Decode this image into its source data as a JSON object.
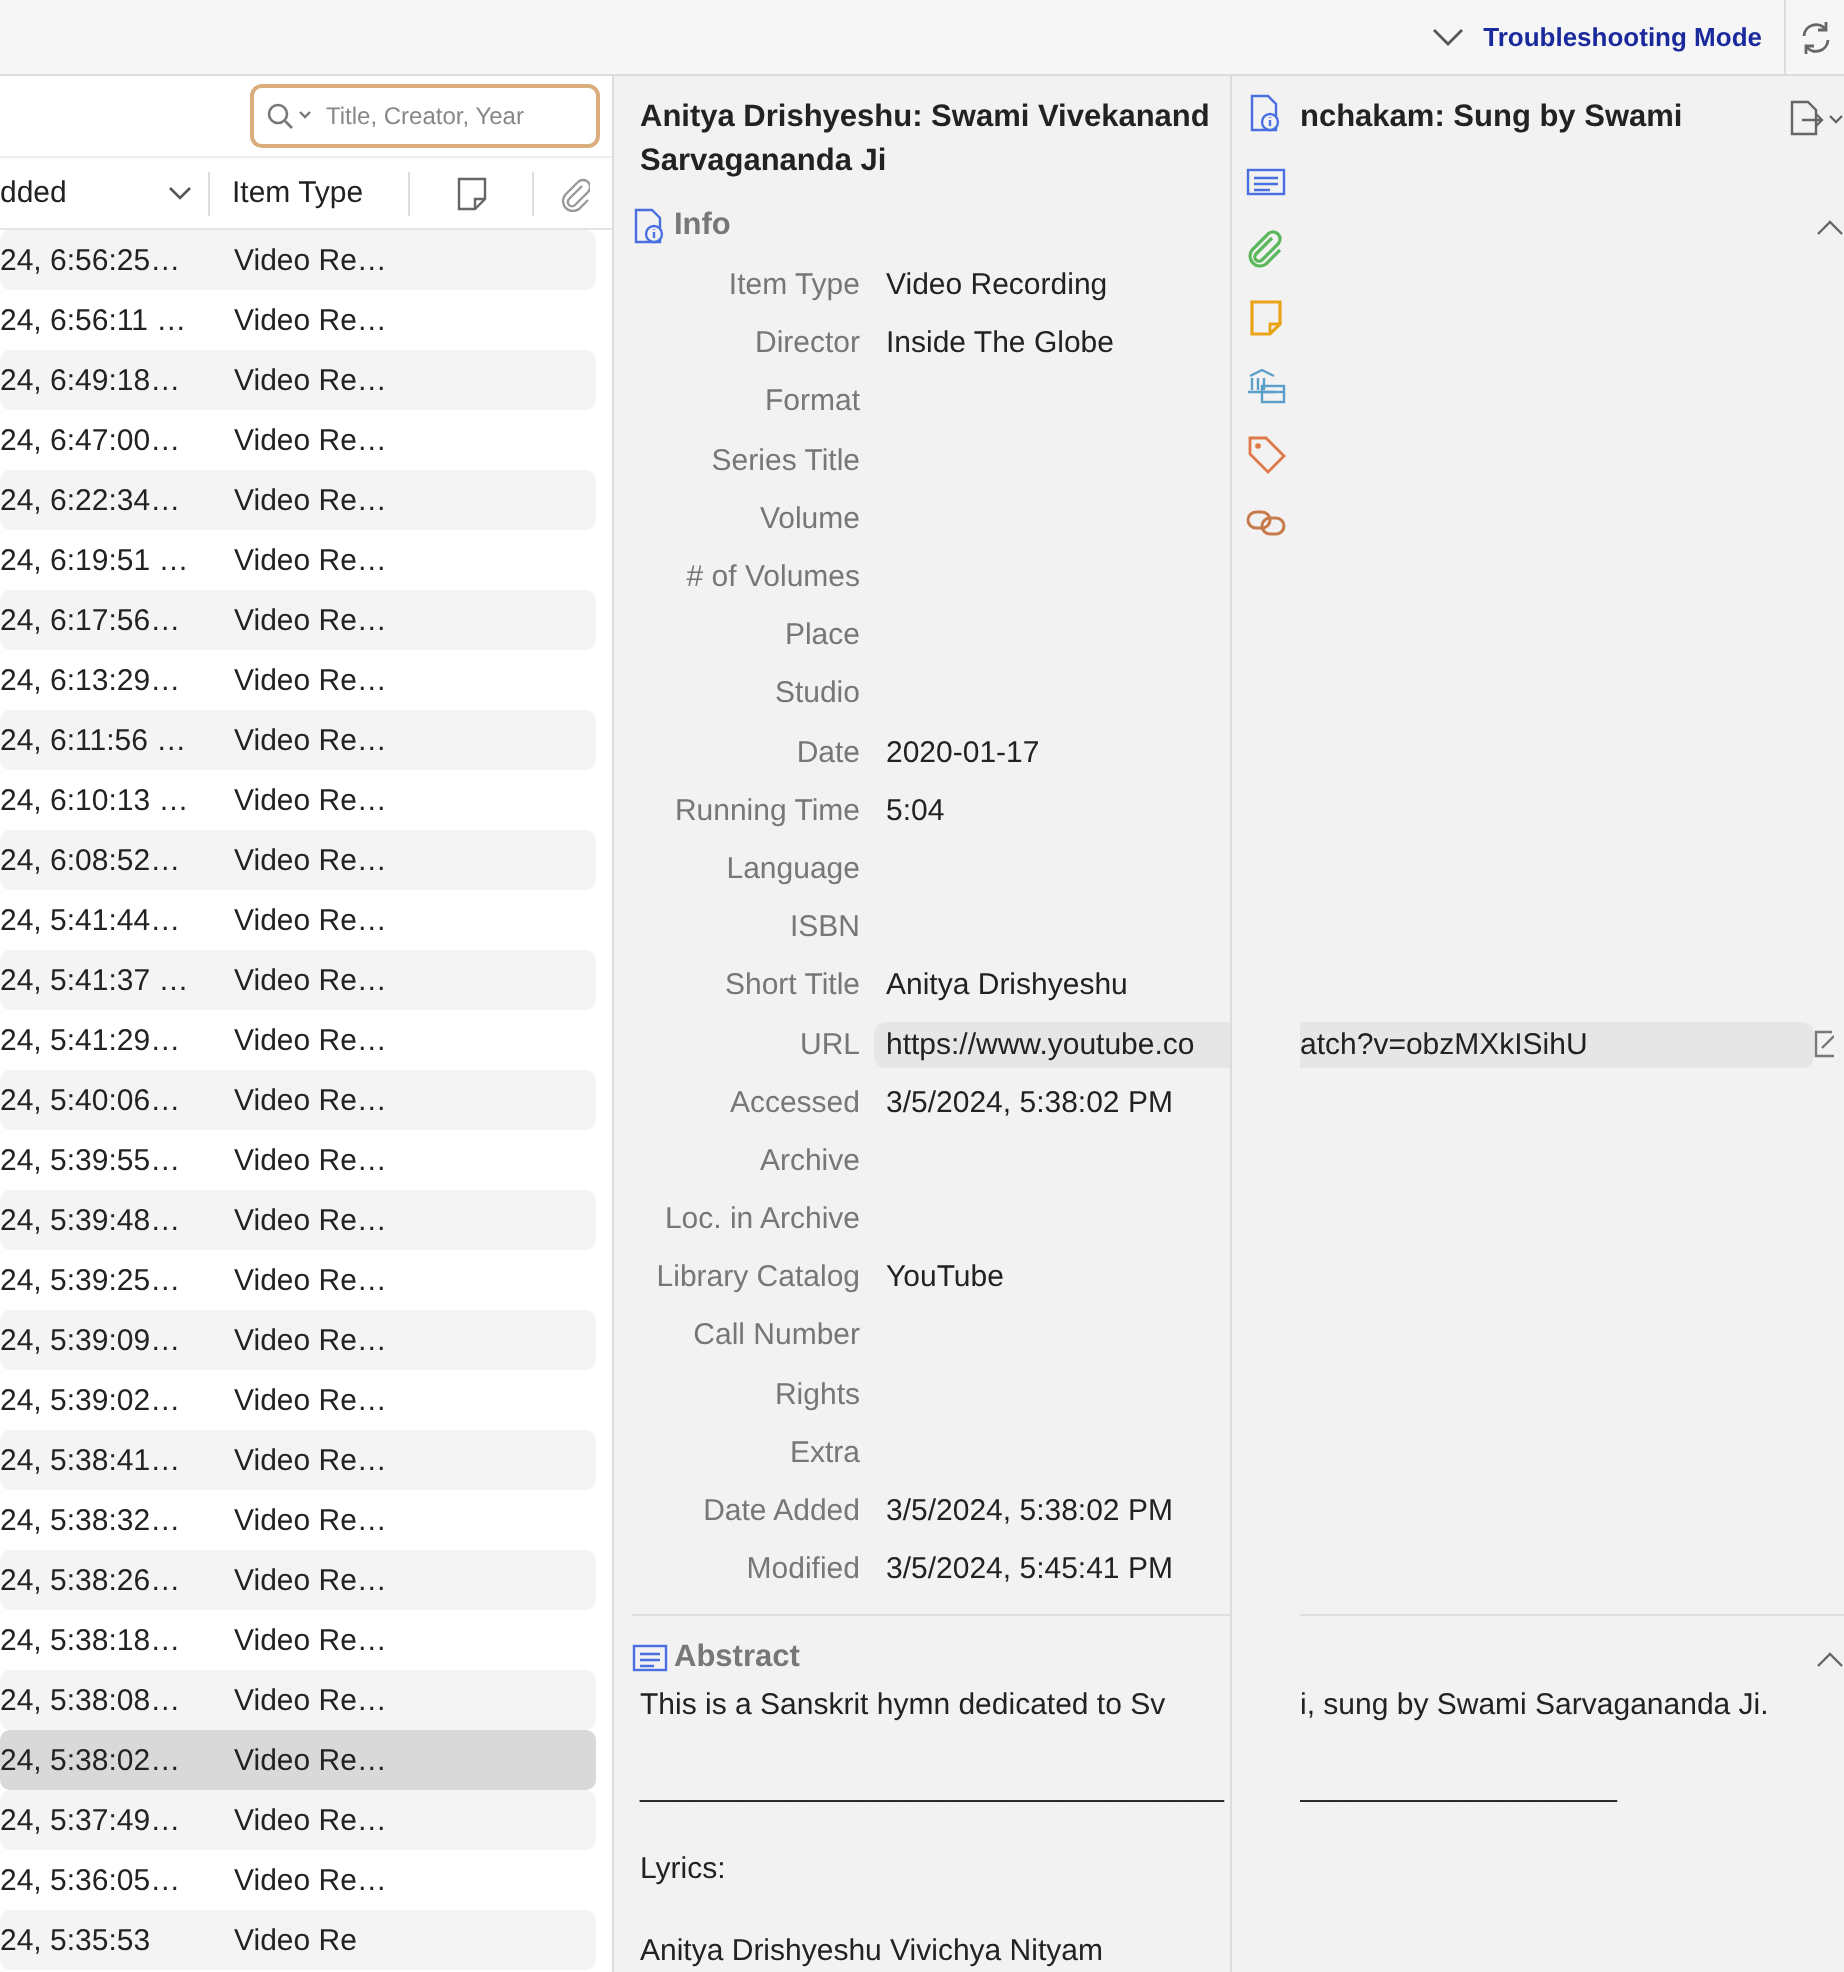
{
  "toolbar": {
    "mode_label": "Troubleshooting Mode"
  },
  "search": {
    "placeholder": "Title, Creator, Year"
  },
  "columns": [
    {
      "label": "dded",
      "sorted": true
    },
    {
      "label": "Item Type",
      "sorted": false
    }
  ],
  "rows": [
    {
      "date_added": "24, 6:56:25…",
      "item_type": "Video Re…",
      "selected": false
    },
    {
      "date_added": "24, 6:56:11 …",
      "item_type": "Video Re…",
      "selected": false
    },
    {
      "date_added": "24, 6:49:18…",
      "item_type": "Video Re…",
      "selected": false
    },
    {
      "date_added": "24, 6:47:00…",
      "item_type": "Video Re…",
      "selected": false
    },
    {
      "date_added": "24, 6:22:34…",
      "item_type": "Video Re…",
      "selected": false
    },
    {
      "date_added": "24, 6:19:51 …",
      "item_type": "Video Re…",
      "selected": false
    },
    {
      "date_added": "24, 6:17:56…",
      "item_type": "Video Re…",
      "selected": false
    },
    {
      "date_added": "24, 6:13:29…",
      "item_type": "Video Re…",
      "selected": false
    },
    {
      "date_added": "24, 6:11:56 …",
      "item_type": "Video Re…",
      "selected": false
    },
    {
      "date_added": "24, 6:10:13 …",
      "item_type": "Video Re…",
      "selected": false
    },
    {
      "date_added": "24, 6:08:52…",
      "item_type": "Video Re…",
      "selected": false
    },
    {
      "date_added": "24, 5:41:44…",
      "item_type": "Video Re…",
      "selected": false
    },
    {
      "date_added": "24, 5:41:37 …",
      "item_type": "Video Re…",
      "selected": false
    },
    {
      "date_added": "24, 5:41:29…",
      "item_type": "Video Re…",
      "selected": false
    },
    {
      "date_added": "24, 5:40:06…",
      "item_type": "Video Re…",
      "selected": false
    },
    {
      "date_added": "24, 5:39:55…",
      "item_type": "Video Re…",
      "selected": false
    },
    {
      "date_added": "24, 5:39:48…",
      "item_type": "Video Re…",
      "selected": false
    },
    {
      "date_added": "24, 5:39:25…",
      "item_type": "Video Re…",
      "selected": false
    },
    {
      "date_added": "24, 5:39:09…",
      "item_type": "Video Re…",
      "selected": false
    },
    {
      "date_added": "24, 5:39:02…",
      "item_type": "Video Re…",
      "selected": false
    },
    {
      "date_added": "24, 5:38:41…",
      "item_type": "Video Re…",
      "selected": false
    },
    {
      "date_added": "24, 5:38:32…",
      "item_type": "Video Re…",
      "selected": false
    },
    {
      "date_added": "24, 5:38:26…",
      "item_type": "Video Re…",
      "selected": false
    },
    {
      "date_added": "24, 5:38:18…",
      "item_type": "Video Re…",
      "selected": false
    },
    {
      "date_added": "24, 5:38:08…",
      "item_type": "Video Re…",
      "selected": false
    },
    {
      "date_added": "24, 5:38:02…",
      "item_type": "Video Re…",
      "selected": true
    },
    {
      "date_added": "24, 5:37:49…",
      "item_type": "Video Re…",
      "selected": false
    },
    {
      "date_added": "24, 5:36:05…",
      "item_type": "Video Re…",
      "selected": false
    },
    {
      "date_added": "24, 5:35:53",
      "item_type": "Video Re",
      "selected": false
    }
  ],
  "item": {
    "title_line1": "Anitya Drishyeshu: Swami Vivekanand",
    "title_line1_continued": "nchakam: Sung by Swami",
    "title_line2": "Sarvagananda Ji",
    "sections": [
      {
        "kind": "info",
        "heading": "Info",
        "expanded": true,
        "fields": [
          {
            "label": "Item Type",
            "value": "Video Recording",
            "kind": "text"
          },
          {
            "label": "Director",
            "value": "Inside The Globe",
            "kind": "text"
          },
          {
            "label": "Format",
            "kind": "text"
          },
          {
            "label": "Series Title",
            "kind": "text"
          },
          {
            "label": "Volume",
            "kind": "text"
          },
          {
            "label": "# of Volumes",
            "kind": "text"
          },
          {
            "label": "Place",
            "kind": "text"
          },
          {
            "label": "Studio",
            "kind": "text"
          },
          {
            "label": "Date",
            "value": "2020-01-17",
            "kind": "text"
          },
          {
            "label": "Running Time",
            "value": "5:04",
            "kind": "text"
          },
          {
            "label": "Language",
            "kind": "text"
          },
          {
            "label": "ISBN",
            "kind": "text"
          },
          {
            "label": "Short Title",
            "value": "Anitya Drishyeshu",
            "kind": "text"
          },
          {
            "label": "URL",
            "value": "https://www.youtube.co",
            "value_continued": "atch?v=obzMXkISihU",
            "kind": "link"
          },
          {
            "label": "Accessed",
            "value": "3/5/2024, 5:38:02 PM",
            "kind": "text"
          },
          {
            "label": "Archive",
            "kind": "text"
          },
          {
            "label": "Loc. in Archive",
            "kind": "text"
          },
          {
            "label": "Library Catalog",
            "value": "YouTube",
            "kind": "text"
          },
          {
            "label": "Call Number",
            "kind": "text"
          },
          {
            "label": "Rights",
            "kind": "text"
          },
          {
            "label": "Extra",
            "kind": "text"
          },
          {
            "label": "Date Added",
            "value": "3/5/2024, 5:38:02 PM",
            "kind": "text"
          },
          {
            "label": "Modified",
            "value": "3/5/2024, 5:45:41 PM",
            "kind": "text"
          }
        ]
      },
      {
        "kind": "abstract",
        "heading": "Abstract",
        "expanded": true,
        "lines": [
          {
            "text": "This is a Sanskrit hymn dedicated to Sv",
            "continued": "i, sung by Swami Sarvagananda Ji."
          },
          {
            "text": "___________________________________",
            "continued": "___________________"
          },
          {
            "text": "Lyrics:"
          },
          {
            "text": "Anitya Drishyeshu Vivichya Nityam"
          }
        ]
      }
    ]
  }
}
